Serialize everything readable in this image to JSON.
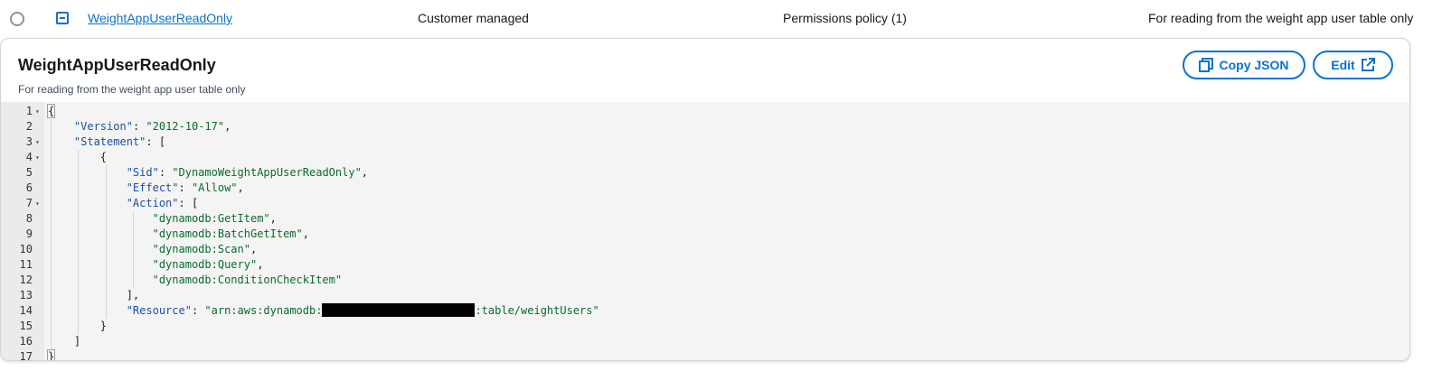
{
  "row": {
    "policy_name": "WeightAppUserReadOnly",
    "type": "Customer managed",
    "attached_entities": "Permissions policy (1)",
    "description": "For reading from the weight app user table only"
  },
  "panel": {
    "title": "WeightAppUserReadOnly",
    "description": "For reading from the weight app user table only",
    "copy_json_label": "Copy JSON",
    "edit_label": "Edit"
  },
  "code": {
    "line_numbers": [
      "1",
      "2",
      "3",
      "4",
      "5",
      "6",
      "7",
      "8",
      "9",
      "10",
      "11",
      "12",
      "13",
      "14",
      "15",
      "16",
      "17"
    ],
    "open_brace": "{",
    "close_brace": "}",
    "version_key": "\"Version\"",
    "version_value": "\"2012-10-17\"",
    "statement_key": "\"Statement\"",
    "sid_key": "\"Sid\"",
    "sid_value": "\"DynamoWeightAppUserReadOnly\"",
    "effect_key": "\"Effect\"",
    "effect_value": "\"Allow\"",
    "action_key": "\"Action\"",
    "actions": [
      "\"dynamodb:GetItem\"",
      "\"dynamodb:BatchGetItem\"",
      "\"dynamodb:Scan\"",
      "\"dynamodb:Query\"",
      "\"dynamodb:ConditionCheckItem\""
    ],
    "resource_key": "\"Resource\"",
    "resource_prefix": "\"arn:aws:dynamodb:",
    "resource_suffix": ":table/weightUsers\""
  },
  "colors": {
    "accent": "#0972d3",
    "key": "#1d4fa8",
    "string": "#0b6b2e",
    "editor_bg": "#f4f4f4"
  }
}
